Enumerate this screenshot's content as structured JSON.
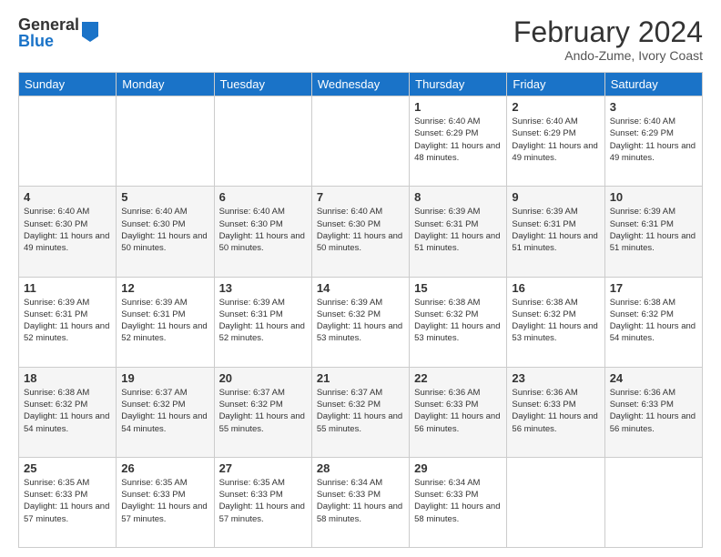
{
  "logo": {
    "general": "General",
    "blue": "Blue"
  },
  "header": {
    "month_year": "February 2024",
    "location": "Ando-Zume, Ivory Coast"
  },
  "weekdays": [
    "Sunday",
    "Monday",
    "Tuesday",
    "Wednesday",
    "Thursday",
    "Friday",
    "Saturday"
  ],
  "weeks": [
    [
      {
        "day": "",
        "sunrise": "",
        "sunset": "",
        "daylight": ""
      },
      {
        "day": "",
        "sunrise": "",
        "sunset": "",
        "daylight": ""
      },
      {
        "day": "",
        "sunrise": "",
        "sunset": "",
        "daylight": ""
      },
      {
        "day": "",
        "sunrise": "",
        "sunset": "",
        "daylight": ""
      },
      {
        "day": "1",
        "sunrise": "Sunrise: 6:40 AM",
        "sunset": "Sunset: 6:29 PM",
        "daylight": "Daylight: 11 hours and 48 minutes."
      },
      {
        "day": "2",
        "sunrise": "Sunrise: 6:40 AM",
        "sunset": "Sunset: 6:29 PM",
        "daylight": "Daylight: 11 hours and 49 minutes."
      },
      {
        "day": "3",
        "sunrise": "Sunrise: 6:40 AM",
        "sunset": "Sunset: 6:29 PM",
        "daylight": "Daylight: 11 hours and 49 minutes."
      }
    ],
    [
      {
        "day": "4",
        "sunrise": "Sunrise: 6:40 AM",
        "sunset": "Sunset: 6:30 PM",
        "daylight": "Daylight: 11 hours and 49 minutes."
      },
      {
        "day": "5",
        "sunrise": "Sunrise: 6:40 AM",
        "sunset": "Sunset: 6:30 PM",
        "daylight": "Daylight: 11 hours and 50 minutes."
      },
      {
        "day": "6",
        "sunrise": "Sunrise: 6:40 AM",
        "sunset": "Sunset: 6:30 PM",
        "daylight": "Daylight: 11 hours and 50 minutes."
      },
      {
        "day": "7",
        "sunrise": "Sunrise: 6:40 AM",
        "sunset": "Sunset: 6:30 PM",
        "daylight": "Daylight: 11 hours and 50 minutes."
      },
      {
        "day": "8",
        "sunrise": "Sunrise: 6:39 AM",
        "sunset": "Sunset: 6:31 PM",
        "daylight": "Daylight: 11 hours and 51 minutes."
      },
      {
        "day": "9",
        "sunrise": "Sunrise: 6:39 AM",
        "sunset": "Sunset: 6:31 PM",
        "daylight": "Daylight: 11 hours and 51 minutes."
      },
      {
        "day": "10",
        "sunrise": "Sunrise: 6:39 AM",
        "sunset": "Sunset: 6:31 PM",
        "daylight": "Daylight: 11 hours and 51 minutes."
      }
    ],
    [
      {
        "day": "11",
        "sunrise": "Sunrise: 6:39 AM",
        "sunset": "Sunset: 6:31 PM",
        "daylight": "Daylight: 11 hours and 52 minutes."
      },
      {
        "day": "12",
        "sunrise": "Sunrise: 6:39 AM",
        "sunset": "Sunset: 6:31 PM",
        "daylight": "Daylight: 11 hours and 52 minutes."
      },
      {
        "day": "13",
        "sunrise": "Sunrise: 6:39 AM",
        "sunset": "Sunset: 6:31 PM",
        "daylight": "Daylight: 11 hours and 52 minutes."
      },
      {
        "day": "14",
        "sunrise": "Sunrise: 6:39 AM",
        "sunset": "Sunset: 6:32 PM",
        "daylight": "Daylight: 11 hours and 53 minutes."
      },
      {
        "day": "15",
        "sunrise": "Sunrise: 6:38 AM",
        "sunset": "Sunset: 6:32 PM",
        "daylight": "Daylight: 11 hours and 53 minutes."
      },
      {
        "day": "16",
        "sunrise": "Sunrise: 6:38 AM",
        "sunset": "Sunset: 6:32 PM",
        "daylight": "Daylight: 11 hours and 53 minutes."
      },
      {
        "day": "17",
        "sunrise": "Sunrise: 6:38 AM",
        "sunset": "Sunset: 6:32 PM",
        "daylight": "Daylight: 11 hours and 54 minutes."
      }
    ],
    [
      {
        "day": "18",
        "sunrise": "Sunrise: 6:38 AM",
        "sunset": "Sunset: 6:32 PM",
        "daylight": "Daylight: 11 hours and 54 minutes."
      },
      {
        "day": "19",
        "sunrise": "Sunrise: 6:37 AM",
        "sunset": "Sunset: 6:32 PM",
        "daylight": "Daylight: 11 hours and 54 minutes."
      },
      {
        "day": "20",
        "sunrise": "Sunrise: 6:37 AM",
        "sunset": "Sunset: 6:32 PM",
        "daylight": "Daylight: 11 hours and 55 minutes."
      },
      {
        "day": "21",
        "sunrise": "Sunrise: 6:37 AM",
        "sunset": "Sunset: 6:32 PM",
        "daylight": "Daylight: 11 hours and 55 minutes."
      },
      {
        "day": "22",
        "sunrise": "Sunrise: 6:36 AM",
        "sunset": "Sunset: 6:33 PM",
        "daylight": "Daylight: 11 hours and 56 minutes."
      },
      {
        "day": "23",
        "sunrise": "Sunrise: 6:36 AM",
        "sunset": "Sunset: 6:33 PM",
        "daylight": "Daylight: 11 hours and 56 minutes."
      },
      {
        "day": "24",
        "sunrise": "Sunrise: 6:36 AM",
        "sunset": "Sunset: 6:33 PM",
        "daylight": "Daylight: 11 hours and 56 minutes."
      }
    ],
    [
      {
        "day": "25",
        "sunrise": "Sunrise: 6:35 AM",
        "sunset": "Sunset: 6:33 PM",
        "daylight": "Daylight: 11 hours and 57 minutes."
      },
      {
        "day": "26",
        "sunrise": "Sunrise: 6:35 AM",
        "sunset": "Sunset: 6:33 PM",
        "daylight": "Daylight: 11 hours and 57 minutes."
      },
      {
        "day": "27",
        "sunrise": "Sunrise: 6:35 AM",
        "sunset": "Sunset: 6:33 PM",
        "daylight": "Daylight: 11 hours and 57 minutes."
      },
      {
        "day": "28",
        "sunrise": "Sunrise: 6:34 AM",
        "sunset": "Sunset: 6:33 PM",
        "daylight": "Daylight: 11 hours and 58 minutes."
      },
      {
        "day": "29",
        "sunrise": "Sunrise: 6:34 AM",
        "sunset": "Sunset: 6:33 PM",
        "daylight": "Daylight: 11 hours and 58 minutes."
      },
      {
        "day": "",
        "sunrise": "",
        "sunset": "",
        "daylight": ""
      },
      {
        "day": "",
        "sunrise": "",
        "sunset": "",
        "daylight": ""
      }
    ]
  ]
}
